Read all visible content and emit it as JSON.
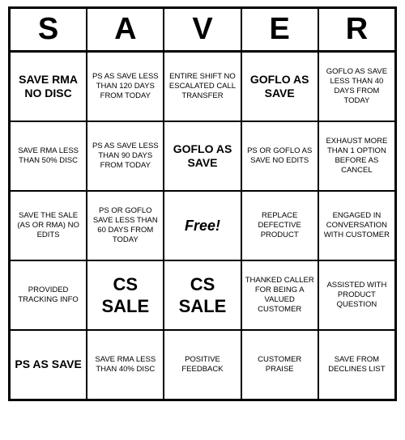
{
  "title": {
    "letters": [
      "S",
      "A",
      "V",
      "E",
      "R"
    ]
  },
  "cells": [
    {
      "id": "r1c1",
      "text": "SAVE RMA NO DISC",
      "style": "large-text"
    },
    {
      "id": "r1c2",
      "text": "PS AS SAVE LESS THAN 120 DAYS FROM TODAY",
      "style": ""
    },
    {
      "id": "r1c3",
      "text": "ENTIRE SHIFT NO ESCALATED CALL TRANSFER",
      "style": ""
    },
    {
      "id": "r1c4",
      "text": "GOFLO AS SAVE",
      "style": "large-text"
    },
    {
      "id": "r1c5",
      "text": "GOFLO AS SAVE LESS THAN 40 DAYS FROM TODAY",
      "style": ""
    },
    {
      "id": "r2c1",
      "text": "SAVE RMA LESS THAN 50% DISC",
      "style": ""
    },
    {
      "id": "r2c2",
      "text": "PS AS SAVE LESS THAN 90 DAYS FROM TODAY",
      "style": ""
    },
    {
      "id": "r2c3",
      "text": "GOFLO AS SAVE",
      "style": "large-text"
    },
    {
      "id": "r2c4",
      "text": "PS OR GOFLO AS SAVE NO EDITS",
      "style": ""
    },
    {
      "id": "r2c5",
      "text": "EXHAUST MORE THAN 1 OPTION BEFORE AS CANCEL",
      "style": ""
    },
    {
      "id": "r3c1",
      "text": "SAVE THE SALE (AS OR RMA) NO EDITS",
      "style": ""
    },
    {
      "id": "r3c2",
      "text": "PS OR GOFLO SAVE LESS THAN 60 DAYS FROM TODAY",
      "style": ""
    },
    {
      "id": "r3c3",
      "text": "Free!",
      "style": "free"
    },
    {
      "id": "r3c4",
      "text": "REPLACE DEFECTIVE PRODUCT",
      "style": ""
    },
    {
      "id": "r3c5",
      "text": "ENGAGED IN CONVERSATION WITH CUSTOMER",
      "style": ""
    },
    {
      "id": "r4c1",
      "text": "PROVIDED TRACKING INFO",
      "style": ""
    },
    {
      "id": "r4c2",
      "text": "CS SALE",
      "style": "cs-sale"
    },
    {
      "id": "r4c3",
      "text": "CS SALE",
      "style": "cs-sale"
    },
    {
      "id": "r4c4",
      "text": "THANKED CALLER FOR BEING A VALUED CUSTOMER",
      "style": ""
    },
    {
      "id": "r4c5",
      "text": "ASSISTED WITH PRODUCT QUESTION",
      "style": ""
    },
    {
      "id": "r5c1",
      "text": "PS AS SAVE",
      "style": "large-text"
    },
    {
      "id": "r5c2",
      "text": "SAVE RMA LESS THAN 40% DISC",
      "style": ""
    },
    {
      "id": "r5c3",
      "text": "POSITIVE FEEDBACK",
      "style": ""
    },
    {
      "id": "r5c4",
      "text": "CUSTOMER PRAISE",
      "style": ""
    },
    {
      "id": "r5c5",
      "text": "SAVE FROM DECLINES LIST",
      "style": ""
    }
  ]
}
